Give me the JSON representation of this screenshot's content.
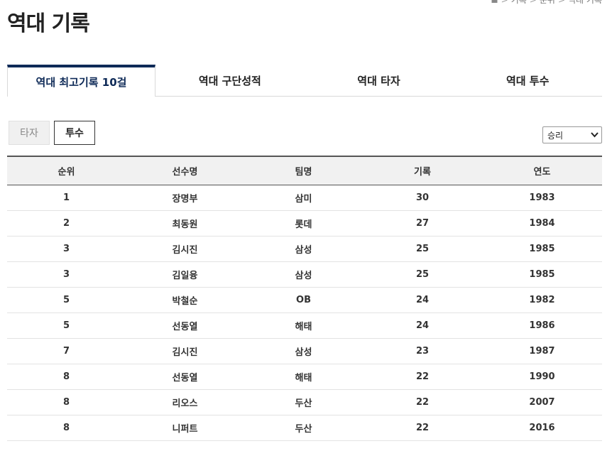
{
  "breadcrumb": {
    "home_icon": "home-icon",
    "items": [
      "기록",
      "순위",
      "역대 기록"
    ]
  },
  "page": {
    "title": "역대 기록"
  },
  "main_tabs": [
    {
      "label": "역대 최고기록 10걸",
      "active": true
    },
    {
      "label": "역대 구단성적",
      "active": false
    },
    {
      "label": "역대 타자",
      "active": false
    },
    {
      "label": "역대 투수",
      "active": false
    }
  ],
  "sub_tabs": [
    {
      "label": "타자",
      "active": false
    },
    {
      "label": "투수",
      "active": true
    }
  ],
  "category_select": {
    "value": "승리"
  },
  "table": {
    "headers": [
      "순위",
      "선수명",
      "팀명",
      "기록",
      "연도"
    ],
    "rows": [
      [
        "1",
        "장명부",
        "삼미",
        "30",
        "1983"
      ],
      [
        "2",
        "최동원",
        "롯데",
        "27",
        "1984"
      ],
      [
        "3",
        "김시진",
        "삼성",
        "25",
        "1985"
      ],
      [
        "3",
        "김일융",
        "삼성",
        "25",
        "1985"
      ],
      [
        "5",
        "박철순",
        "OB",
        "24",
        "1982"
      ],
      [
        "5",
        "선동열",
        "해태",
        "24",
        "1986"
      ],
      [
        "7",
        "김시진",
        "삼성",
        "23",
        "1987"
      ],
      [
        "8",
        "선동열",
        "해태",
        "22",
        "1990"
      ],
      [
        "8",
        "리오스",
        "두산",
        "22",
        "2007"
      ],
      [
        "8",
        "니퍼트",
        "두산",
        "22",
        "2016"
      ]
    ]
  },
  "colors": {
    "accent": "#0e2a57",
    "header_bg": "#f1f1f1"
  }
}
